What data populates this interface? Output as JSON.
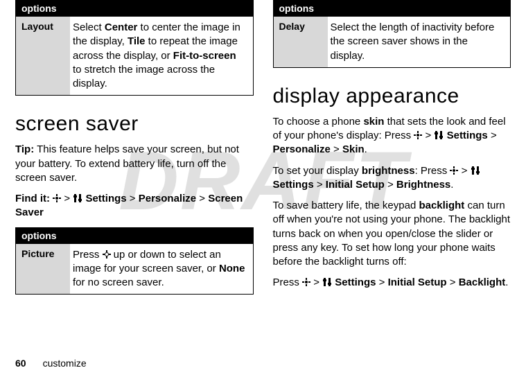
{
  "watermark": "DRAFT",
  "left": {
    "table1": {
      "header": "options",
      "rows": [
        {
          "label": "Layout",
          "body_parts": {
            "t1": "Select ",
            "b1": "Center",
            "t2": " to center the image in the display, ",
            "b2": "Tile",
            "t3": " to repeat the image across the display, or ",
            "b3": "Fit-to-screen",
            "t4": " to stretch the image across the display."
          }
        }
      ]
    },
    "h1": "screen saver",
    "tip": {
      "label": "Tip:",
      "text": " This feature helps save your screen, but not your battery. To extend battery life, turn off the screen saver."
    },
    "findit": {
      "label": "Find it: ",
      "b1": "Settings",
      "b2": "Personalize",
      "b3": "Screen Saver"
    },
    "table2": {
      "header": "options",
      "rows": [
        {
          "label": "Picture",
          "body_parts": {
            "t1": "Press ",
            "t2": " up or down to select an image for your screen saver, or ",
            "b1": "None",
            "t3": " for no screen saver."
          }
        }
      ]
    }
  },
  "right": {
    "table1": {
      "header": "options",
      "rows": [
        {
          "label": "Delay",
          "body": "Select the length of inactivity before the screen saver shows in the display."
        }
      ]
    },
    "h1": "display appearance",
    "p1": {
      "t1": "To choose a phone ",
      "b1": "skin",
      "t2": " that sets the look and feel of your phone's display: Press ",
      "path_b1": "Settings",
      "path_b2": "Personalize",
      "path_b3": "Skin",
      "t3": "."
    },
    "p2": {
      "t1": "To set your display ",
      "b1": "brightness",
      "t2": ": Press ",
      "path_b1": "Settings",
      "path_b2": "Initial Setup",
      "path_b3": "Brightness",
      "t3": "."
    },
    "p3": {
      "t1": "To save battery life, the keypad ",
      "b1": "backlight",
      "t2": " can turn off when you're not using your phone. The backlight turns back on when you open/close the slider or press any key. To set how long your phone waits before the backlight turns off:"
    },
    "p4": {
      "t1": "Press ",
      "path_b1": "Settings",
      "path_b2": "Initial Setup",
      "path_b3": "Backlight",
      "t2": "."
    }
  },
  "footer": {
    "page": "60",
    "section": "customize"
  },
  "glyphs": {
    "chev": ">"
  }
}
